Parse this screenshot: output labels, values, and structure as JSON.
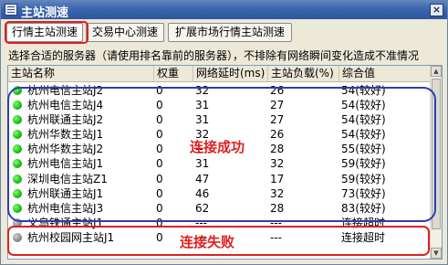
{
  "window": {
    "title": "主站测速",
    "close_label": "×"
  },
  "tabs": [
    {
      "label": "行情主站测速",
      "active": true
    },
    {
      "label": "交易中心测速",
      "active": false
    },
    {
      "label": "扩展市场行情主站测速",
      "active": false
    }
  ],
  "description": "选择合适的服务器（请使用排名靠前的服务器），不排除有网络瞬间变化造成不准情况",
  "columns": {
    "name": "主站名称",
    "weight": "权重",
    "delay": "网络延时(ms)",
    "load": "主站负载(%)",
    "rating": "综合值"
  },
  "rows": [
    {
      "name": "杭州电信主站J2",
      "weight": "0",
      "delay": "32",
      "load": "26",
      "rating": "54(较好)",
      "status": "green"
    },
    {
      "name": "杭州电信主站J4",
      "weight": "0",
      "delay": "31",
      "load": "27",
      "rating": "54(较好)",
      "status": "green"
    },
    {
      "name": "杭州联通主站J2",
      "weight": "0",
      "delay": "31",
      "load": "27",
      "rating": "54(较好)",
      "status": "green"
    },
    {
      "name": "杭州华数主站J1",
      "weight": "0",
      "delay": "32",
      "load": "26",
      "rating": "54(较好)",
      "status": "green"
    },
    {
      "name": "杭州华数主站J2",
      "weight": "0",
      "delay": "--",
      "load": "28",
      "rating": "55(较好)",
      "status": "green"
    },
    {
      "name": "杭州电信主站J1",
      "weight": "0",
      "delay": "31",
      "load": "32",
      "rating": "59(较好)",
      "status": "green"
    },
    {
      "name": "深圳电信主站Z1",
      "weight": "0",
      "delay": "47",
      "load": "17",
      "rating": "59(较好)",
      "status": "green"
    },
    {
      "name": "杭州联通主站J1",
      "weight": "0",
      "delay": "46",
      "load": "32",
      "rating": "73(较好)",
      "status": "green"
    },
    {
      "name": "杭州电信主站J3",
      "weight": "0",
      "delay": "62",
      "load": "28",
      "rating": "83(较好)",
      "status": "green"
    },
    {
      "name": "义乌铁通主站J1",
      "weight": "0",
      "delay": "---",
      "load": "---",
      "rating": "连接超时",
      "status": "gray"
    },
    {
      "name": "杭州校园网主站J1",
      "weight": "0",
      "delay": "---",
      "load": "---",
      "rating": "连接超时",
      "status": "gray"
    }
  ],
  "annotations": {
    "success": "连接成功",
    "failure": "连接失败"
  },
  "colors": {
    "annotation_red": "#e02020",
    "annotation_blue": "#2a3fb0",
    "title_bar": "#2c57a0"
  }
}
